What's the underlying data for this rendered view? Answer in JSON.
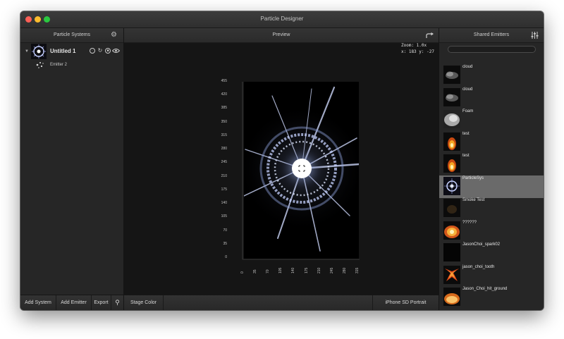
{
  "window": {
    "title": "Particle Designer"
  },
  "left_panel": {
    "header": "Particle Systems",
    "system_name": "Untitled 1",
    "emitter_name": "Emitter 2",
    "buttons": {
      "add_system": "Add System",
      "add_emitter": "Add Emitter",
      "export": "Export"
    }
  },
  "preview": {
    "header": "Preview",
    "zoom_text": "Zoom: 1.0x",
    "coords_text": "x: 183 y: -27",
    "y_ticks": [
      "455",
      "420",
      "385",
      "350",
      "315",
      "280",
      "245",
      "210",
      "175",
      "140",
      "105",
      "70",
      "35",
      "0"
    ],
    "x_ticks": [
      "0",
      "35",
      "70",
      "105",
      "140",
      "175",
      "210",
      "245",
      "280",
      "315"
    ],
    "stage_color_label": "Stage Color",
    "device_label": "iPhone SD Portrait"
  },
  "right_panel": {
    "header": "Shared Emitters",
    "items": [
      {
        "label": "cloud",
        "thumb": "cloud"
      },
      {
        "label": "cloud",
        "thumb": "cloud"
      },
      {
        "label": "Foam",
        "thumb": "foam"
      },
      {
        "label": "test",
        "thumb": "fire"
      },
      {
        "label": "test",
        "thumb": "fire"
      },
      {
        "label": "ParticleSys",
        "thumb": "burst",
        "selected": true
      },
      {
        "label": "Smoke Test",
        "thumb": "smoke"
      },
      {
        "label": "??????",
        "thumb": "fireball"
      },
      {
        "label": "JasonChoi_spark02",
        "thumb": "dark"
      },
      {
        "label": "jason_choi_tooth",
        "thumb": "tooth"
      },
      {
        "label": "Jason_Choi_hit_ground",
        "thumb": "glow"
      }
    ]
  },
  "colors": {
    "accent_close": "#fc5f57",
    "accent_min": "#fdbc2e",
    "accent_max": "#2ac840",
    "selection": "#6a6a6a"
  }
}
